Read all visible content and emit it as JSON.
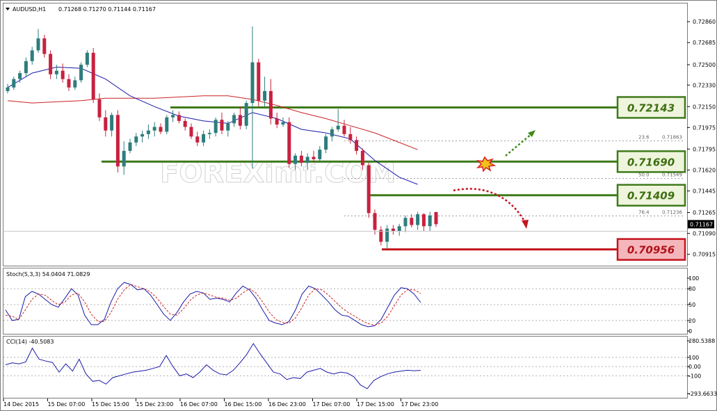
{
  "header": {
    "symbol": "AUDUSD,H1",
    "ohlc": "0.71268 0.71270 0.71144 0.71167"
  },
  "watermark": "FOREXimf.COM",
  "colors": {
    "bull": "#2e7d7d",
    "bear": "#c8213f",
    "ma_fast": "#1a1aa8",
    "ma_slow": "#cc2222",
    "level_green_border": "#3f7a1a",
    "level_green_fill": "#eef5dc",
    "level_red_border": "#c4141e",
    "level_red_fill": "#f5b6bb",
    "price_box_text": "#3e6e12",
    "price_box_text_red": "#b0121a"
  },
  "chart_data": [
    {
      "type": "candlestick",
      "title": "AUDUSD,H1",
      "ylim": [
        0.70832,
        0.72948
      ],
      "y_ticks": [
        "0.72860",
        "0.72685",
        "0.72500",
        "0.72330",
        "0.72150",
        "0.71975",
        "0.71795",
        "0.71620",
        "0.71445",
        "0.71265",
        "0.71090",
        "0.70915"
      ],
      "current_price": "0.71167",
      "x_labels": [
        "14 Dec 2015",
        "15 Dec 07:00",
        "15 Dec 15:00",
        "15 Dec 23:00",
        "16 Dec 07:00",
        "16 Dec 15:00",
        "16 Dec 23:00",
        "17 Dec 07:00",
        "17 Dec 15:00",
        "17 Dec 23:00"
      ],
      "candles": [
        [
          0.7228,
          0.7234,
          0.7226,
          0.7231
        ],
        [
          0.7231,
          0.724,
          0.7229,
          0.7238
        ],
        [
          0.7238,
          0.7245,
          0.7235,
          0.7243
        ],
        [
          0.7243,
          0.7256,
          0.724,
          0.7253
        ],
        [
          0.7253,
          0.7265,
          0.725,
          0.7262
        ],
        [
          0.7262,
          0.728,
          0.726,
          0.7272
        ],
        [
          0.7272,
          0.7275,
          0.7256,
          0.7259
        ],
        [
          0.7259,
          0.7262,
          0.7238,
          0.7242
        ],
        [
          0.7242,
          0.725,
          0.7238,
          0.7245
        ],
        [
          0.7245,
          0.7251,
          0.7235,
          0.7238
        ],
        [
          0.7238,
          0.7242,
          0.7228,
          0.7231
        ],
        [
          0.7231,
          0.724,
          0.7229,
          0.7237
        ],
        [
          0.7237,
          0.7252,
          0.7235,
          0.725
        ],
        [
          0.725,
          0.7262,
          0.7248,
          0.726
        ],
        [
          0.726,
          0.7264,
          0.7218,
          0.7221
        ],
        [
          0.7221,
          0.7226,
          0.7203,
          0.7206
        ],
        [
          0.7206,
          0.7212,
          0.719,
          0.7195
        ],
        [
          0.7195,
          0.721,
          0.719,
          0.7208
        ],
        [
          0.7208,
          0.7212,
          0.716,
          0.7165
        ],
        [
          0.7165,
          0.7186,
          0.7158,
          0.7178
        ],
        [
          0.7178,
          0.7188,
          0.7176,
          0.7185
        ],
        [
          0.7185,
          0.7193,
          0.7182,
          0.719
        ],
        [
          0.719,
          0.7195,
          0.7185,
          0.7192
        ],
        [
          0.7192,
          0.72,
          0.7188,
          0.7195
        ],
        [
          0.7195,
          0.7202,
          0.719,
          0.7198
        ],
        [
          0.7198,
          0.7201,
          0.7192,
          0.7194
        ],
        [
          0.7194,
          0.7208,
          0.7192,
          0.7206
        ],
        [
          0.7206,
          0.7212,
          0.7202,
          0.7208
        ],
        [
          0.7208,
          0.7211,
          0.7201,
          0.7203
        ],
        [
          0.7203,
          0.7205,
          0.7195,
          0.7198
        ],
        [
          0.7198,
          0.7201,
          0.7188,
          0.719
        ],
        [
          0.719,
          0.7194,
          0.7182,
          0.7185
        ],
        [
          0.7185,
          0.7195,
          0.7182,
          0.7192
        ],
        [
          0.7192,
          0.7196,
          0.7188,
          0.7193
        ],
        [
          0.7193,
          0.7206,
          0.719,
          0.7204
        ],
        [
          0.7204,
          0.721,
          0.7192,
          0.7195
        ],
        [
          0.7195,
          0.7203,
          0.719,
          0.7201
        ],
        [
          0.7201,
          0.721,
          0.7198,
          0.7208
        ],
        [
          0.7208,
          0.7215,
          0.7196,
          0.7199
        ],
        [
          0.7199,
          0.722,
          0.7196,
          0.7218
        ],
        [
          0.7218,
          0.7282,
          0.7163,
          0.7252
        ],
        [
          0.7252,
          0.7255,
          0.7215,
          0.722
        ],
        [
          0.722,
          0.724,
          0.7215,
          0.7228
        ],
        [
          0.7228,
          0.7238,
          0.72,
          0.7205
        ],
        [
          0.7205,
          0.721,
          0.7197,
          0.72
        ],
        [
          0.72,
          0.7206,
          0.7198,
          0.7202
        ],
        [
          0.7202,
          0.7206,
          0.7164,
          0.7167
        ],
        [
          0.7167,
          0.7176,
          0.7162,
          0.7174
        ],
        [
          0.7174,
          0.7178,
          0.7165,
          0.7168
        ],
        [
          0.7168,
          0.7176,
          0.7162,
          0.7173
        ],
        [
          0.7173,
          0.7178,
          0.7168,
          0.7171
        ],
        [
          0.7171,
          0.7182,
          0.7168,
          0.7179
        ],
        [
          0.7179,
          0.7192,
          0.7176,
          0.719
        ],
        [
          0.719,
          0.7198,
          0.7186,
          0.7196
        ],
        [
          0.7196,
          0.7213,
          0.7194,
          0.7199
        ],
        [
          0.7199,
          0.7204,
          0.719,
          0.7192
        ],
        [
          0.7192,
          0.7198,
          0.7184,
          0.7187
        ],
        [
          0.7187,
          0.719,
          0.7175,
          0.7178
        ],
        [
          0.7178,
          0.718,
          0.7162,
          0.7166
        ],
        [
          0.7166,
          0.7168,
          0.7122,
          0.7126
        ],
        [
          0.7126,
          0.7129,
          0.7108,
          0.7112
        ],
        [
          0.7112,
          0.7115,
          0.7099,
          0.7102
        ],
        [
          0.7102,
          0.7116,
          0.7096,
          0.7113
        ],
        [
          0.7113,
          0.7116,
          0.7108,
          0.7111
        ],
        [
          0.7111,
          0.7117,
          0.7107,
          0.7115
        ],
        [
          0.7115,
          0.7124,
          0.711,
          0.7122
        ],
        [
          0.7122,
          0.7125,
          0.7114,
          0.7116
        ],
        [
          0.7116,
          0.7127,
          0.7112,
          0.7125
        ],
        [
          0.7125,
          0.7126,
          0.7111,
          0.7115
        ],
        [
          0.7115,
          0.7127,
          0.7111,
          0.7124
        ],
        [
          0.71268,
          0.7127,
          0.71144,
          0.71167
        ]
      ],
      "ma_fast": [
        [
          0,
          0.7231
        ],
        [
          4,
          0.7243
        ],
        [
          8,
          0.7248
        ],
        [
          12,
          0.7247
        ],
        [
          16,
          0.7238
        ],
        [
          20,
          0.7224
        ],
        [
          24,
          0.7215
        ],
        [
          28,
          0.7207
        ],
        [
          32,
          0.7203
        ],
        [
          36,
          0.7201
        ],
        [
          40,
          0.721
        ],
        [
          44,
          0.7205
        ],
        [
          48,
          0.7196
        ],
        [
          52,
          0.7193
        ],
        [
          56,
          0.7188
        ],
        [
          60,
          0.717
        ],
        [
          64,
          0.7156
        ],
        [
          67,
          0.715
        ]
      ],
      "ma_slow": [
        [
          0,
          0.722
        ],
        [
          4,
          0.7218
        ],
        [
          8,
          0.7219
        ],
        [
          12,
          0.722
        ],
        [
          16,
          0.7222
        ],
        [
          20,
          0.7222
        ],
        [
          24,
          0.7222
        ],
        [
          28,
          0.7223
        ],
        [
          32,
          0.7224
        ],
        [
          36,
          0.7224
        ],
        [
          40,
          0.7221
        ],
        [
          44,
          0.7216
        ],
        [
          48,
          0.721
        ],
        [
          52,
          0.7205
        ],
        [
          56,
          0.7199
        ],
        [
          60,
          0.7193
        ],
        [
          64,
          0.7185
        ],
        [
          67,
          0.7179
        ]
      ],
      "levels": [
        {
          "value": "0.72143",
          "price": 0.72143,
          "kind": "green"
        },
        {
          "value": "0.71690",
          "price": 0.7169,
          "kind": "green"
        },
        {
          "value": "0.71409",
          "price": 0.71409,
          "kind": "green"
        },
        {
          "value": "0.70956",
          "price": 0.70956,
          "kind": "red"
        }
      ],
      "fibonacci": [
        {
          "label": "23.6",
          "value": "0.71863",
          "price": 0.71863
        },
        {
          "label": "50.0",
          "value": "0.71549",
          "price": 0.71549
        },
        {
          "label": "76.4",
          "value": "0.71236",
          "price": 0.71236
        }
      ]
    },
    {
      "type": "line",
      "title": "Stoch(5,3,3) 54.0404 71.0829",
      "ylim": [
        0,
        100
      ],
      "y_ticks": [
        "100",
        "80",
        "50",
        "20",
        "0"
      ],
      "series": [
        {
          "values": [
            40,
            20,
            22,
            65,
            75,
            70,
            60,
            50,
            45,
            62,
            80,
            68,
            30,
            12,
            12,
            22,
            55,
            80,
            92,
            88,
            78,
            80,
            68,
            50,
            32,
            20,
            35,
            55,
            70,
            75,
            72,
            60,
            62,
            60,
            55,
            72,
            85,
            78,
            62,
            40,
            20,
            15,
            12,
            18,
            40,
            70,
            85,
            80,
            68,
            55,
            40,
            30,
            28,
            20,
            12,
            8,
            10,
            22,
            45,
            68,
            82,
            80,
            70,
            54
          ]
        },
        {
          "values": [
            30,
            28,
            22,
            40,
            60,
            70,
            68,
            58,
            50,
            55,
            68,
            72,
            55,
            32,
            18,
            18,
            35,
            60,
            78,
            88,
            84,
            80,
            74,
            62,
            46,
            32,
            30,
            42,
            58,
            68,
            72,
            68,
            64,
            62,
            58,
            62,
            72,
            80,
            72,
            55,
            36,
            22,
            16,
            15,
            25,
            45,
            68,
            80,
            78,
            68,
            56,
            44,
            35,
            28,
            20,
            14,
            11,
            15,
            28,
            48,
            68,
            78,
            78,
            71
          ]
        }
      ]
    },
    {
      "type": "line",
      "title": "CCI(14) -40.5083",
      "ylim": [
        -293.6633,
        280.5388
      ],
      "y_ticks": [
        "280.5388",
        "100",
        "0.00",
        "-100",
        "-293.6633"
      ],
      "series": [
        {
          "values": [
            20,
            40,
            30,
            50,
            200,
            80,
            60,
            45,
            -60,
            30,
            -50,
            80,
            -80,
            -160,
            -150,
            -190,
            -120,
            -100,
            -80,
            -60,
            -50,
            -40,
            -20,
            0,
            120,
            0,
            -100,
            -80,
            -120,
            -60,
            20,
            -40,
            -80,
            -90,
            -40,
            40,
            130,
            250,
            140,
            40,
            -60,
            -80,
            -140,
            -120,
            -130,
            -60,
            -40,
            -20,
            -60,
            -80,
            -60,
            -70,
            -110,
            -200,
            -240,
            -150,
            -110,
            -80,
            -60,
            -50,
            -40,
            -45,
            -41
          ]
        }
      ]
    }
  ]
}
